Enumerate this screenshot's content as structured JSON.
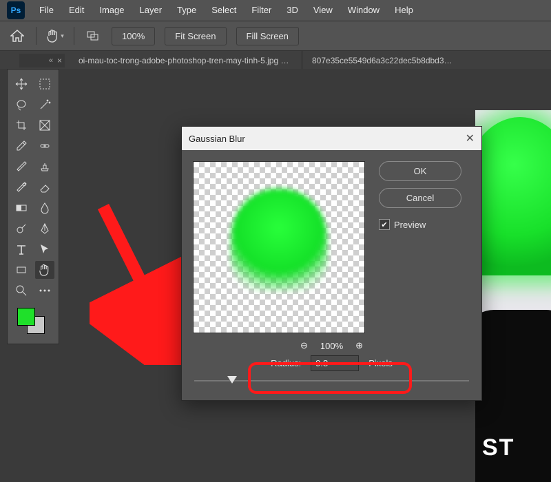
{
  "app": {
    "logo_text": "Ps"
  },
  "menu": {
    "items": [
      "File",
      "Edit",
      "Image",
      "Layer",
      "Type",
      "Select",
      "Filter",
      "3D",
      "View",
      "Window",
      "Help"
    ]
  },
  "optionsbar": {
    "zoom_label": "100%",
    "fit_screen": "Fit Screen",
    "fill_screen": "Fill Screen"
  },
  "panel": {
    "collapse_hint": "«"
  },
  "tabs": {
    "items": [
      "oi-mau-toc-trong-adobe-photoshop-tren-may-tinh-5.jpg @ …",
      "807e35ce5549d6a3c22dec5b8dbd3…"
    ]
  },
  "tools": {
    "row1": [
      "move",
      "marquee"
    ],
    "row2": [
      "lasso",
      "wand"
    ],
    "row3": [
      "crop",
      "frame"
    ],
    "row4": [
      "eyedropper",
      "healing"
    ],
    "row5": [
      "brush",
      "stamp"
    ],
    "row6": [
      "history",
      "eraser"
    ],
    "row7": [
      "gradient",
      "blur"
    ],
    "row8": [
      "dodge",
      "pen"
    ],
    "row9": [
      "type",
      "path"
    ],
    "row10": [
      "rect",
      "hand"
    ],
    "row11": [
      "zoom",
      "ellipsis"
    ]
  },
  "dialog": {
    "title": "Gaussian Blur",
    "ok": "OK",
    "cancel": "Cancel",
    "preview_label": "Preview",
    "preview_checked": true,
    "zoom_out": "⊖",
    "zoom_pct": "100%",
    "zoom_in": "⊕",
    "radius_label": "Radius:",
    "radius_value": "9.8",
    "radius_unit": "Pixels"
  },
  "canvas_tee_text": "ST",
  "colors": {
    "foreground": "#1fe02a",
    "background": "#c8c8c8",
    "accent_red": "#ff1a1a"
  }
}
